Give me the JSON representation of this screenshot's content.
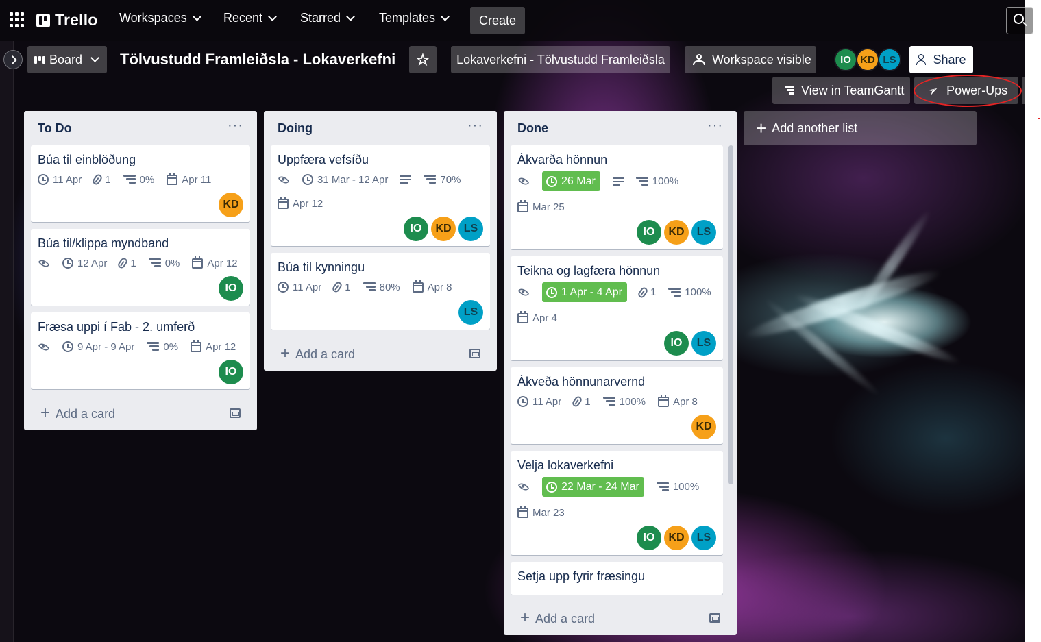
{
  "colors": {
    "accent_green": "#61bd4f",
    "list_bg": "#ebecf0",
    "avatar_io": "#1d8c4e",
    "avatar_kd": "#f6a019",
    "avatar_ls": "#00a0c6",
    "annotation_red": "#e52424"
  },
  "topnav": {
    "logo": "Trello",
    "workspaces": "Workspaces",
    "recent": "Recent",
    "starred": "Starred",
    "templates": "Templates",
    "create": "Create"
  },
  "board": {
    "view_label": "Board",
    "title": "Tölvustudd Framleiðsla - Lokaverkefni",
    "workspace_name": "Lokaverkefni - Tölvustudd Framleiðsla",
    "visibility": "Workspace visible",
    "members": [
      "IO",
      "KD",
      "LS"
    ],
    "share": "Share",
    "teamgantt": "View in TeamGantt",
    "powerups": "Power-Ups",
    "star_icon": "★"
  },
  "lists": [
    {
      "title": "To Do",
      "menu": "···",
      "add_card": "Add a card",
      "cards": [
        {
          "title": "Búa til einblöðung",
          "watch": false,
          "due": "11 Apr",
          "due_green": false,
          "desc": false,
          "attachments": "1",
          "progress": "0%",
          "start": "Apr 11",
          "members": [
            "KD"
          ]
        },
        {
          "title": "Búa til/klippa myndband",
          "watch": true,
          "due": "12 Apr",
          "due_green": false,
          "desc": false,
          "attachments": "1",
          "progress": "0%",
          "start": "Apr 12",
          "members": [
            "IO"
          ]
        },
        {
          "title": "Fræsa uppi í Fab - 2. umferð",
          "watch": true,
          "due": "9 Apr - 9 Apr",
          "due_green": false,
          "desc": false,
          "attachments": "",
          "progress": "0%",
          "start": "Apr 12",
          "members": [
            "IO"
          ]
        }
      ]
    },
    {
      "title": "Doing",
      "menu": "···",
      "add_card": "Add a card",
      "cards": [
        {
          "title": "Uppfæra vefsíðu",
          "watch": true,
          "due": "31 Mar - 12 Apr",
          "due_green": false,
          "desc": true,
          "attachments": "",
          "progress": "70%",
          "start": "Apr 12",
          "members": [
            "IO",
            "KD",
            "LS"
          ]
        },
        {
          "title": "Búa til kynningu",
          "watch": false,
          "due": "11 Apr",
          "due_green": false,
          "desc": false,
          "attachments": "1",
          "progress": "80%",
          "start": "Apr 8",
          "members": [
            "LS"
          ]
        }
      ]
    },
    {
      "title": "Done",
      "menu": "···",
      "add_card": "Add a card",
      "cards": [
        {
          "title": "Ákvarða hönnun",
          "watch": true,
          "due": "26 Mar",
          "due_green": true,
          "desc": true,
          "attachments": "",
          "progress": "100%",
          "start": "Mar 25",
          "members": [
            "IO",
            "KD",
            "LS"
          ]
        },
        {
          "title": "Teikna og lagfæra hönnun",
          "watch": true,
          "due": "1 Apr - 4 Apr",
          "due_green": true,
          "desc": false,
          "attachments": "1",
          "progress": "100%",
          "start": "Apr 4",
          "members": [
            "IO",
            "LS"
          ]
        },
        {
          "title": "Ákveða hönnunarvernd",
          "watch": false,
          "due": "11 Apr",
          "due_green": false,
          "desc": false,
          "attachments": "1",
          "progress": "100%",
          "start": "Apr 8",
          "members": [
            "KD"
          ]
        },
        {
          "title": "Velja lokaverkefni",
          "watch": true,
          "due": "22 Mar - 24 Mar",
          "due_green": true,
          "desc": false,
          "attachments": "",
          "progress": "100%",
          "start": "Mar 23",
          "members": [
            "IO",
            "KD",
            "LS"
          ]
        },
        {
          "title": "Setja upp fyrir fræsingu",
          "watch": false,
          "due": "",
          "due_green": false,
          "desc": false,
          "attachments": "",
          "progress": "",
          "start": "",
          "members": []
        }
      ]
    }
  ],
  "add_list": "Add another list"
}
